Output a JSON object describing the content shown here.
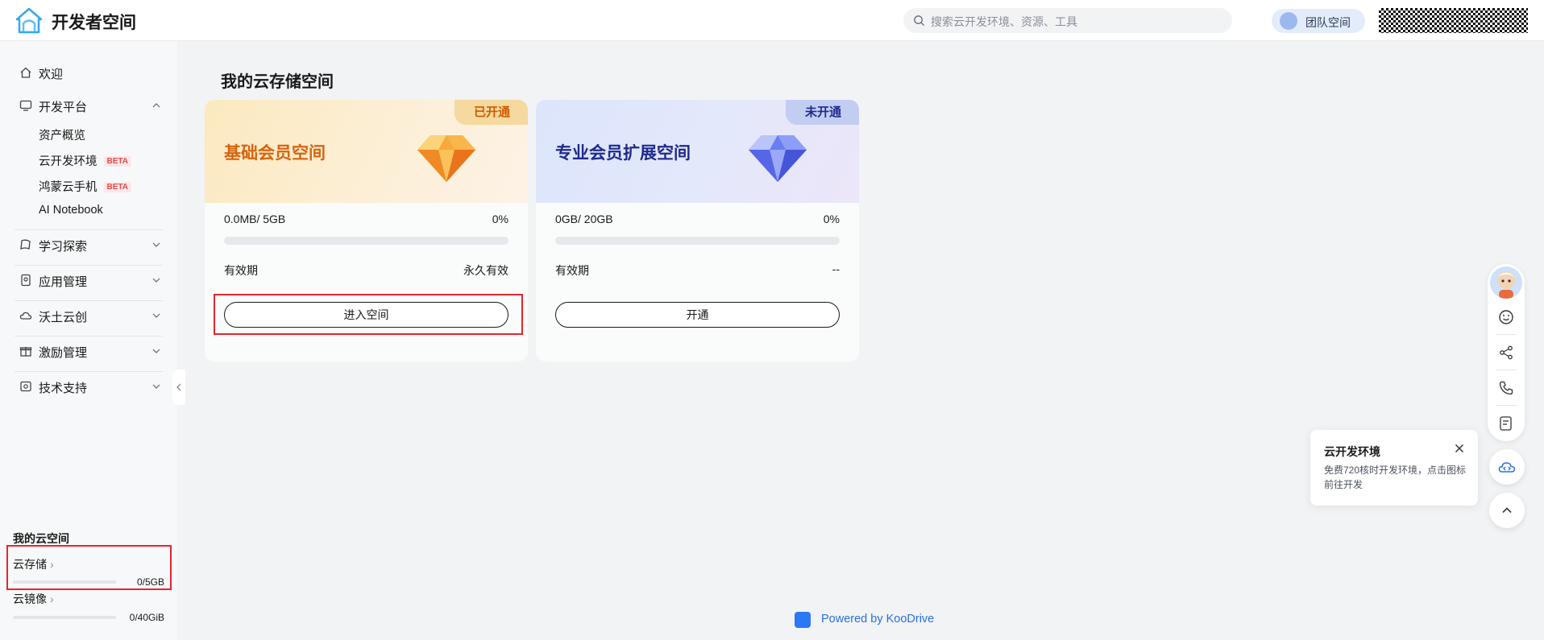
{
  "header": {
    "brand": "开发者空间",
    "search_placeholder": "搜索云开发环境、资源、工具",
    "team_label": "团队空间"
  },
  "sidebar": {
    "items": [
      {
        "label": "欢迎",
        "icon": "home-icon"
      },
      {
        "label": "开发平台",
        "icon": "monitor-icon",
        "expanded": true
      },
      {
        "label": "学习探索",
        "icon": "book-icon"
      },
      {
        "label": "应用管理",
        "icon": "app-icon"
      },
      {
        "label": "沃土云创",
        "icon": "cloud-icon"
      },
      {
        "label": "激励管理",
        "icon": "gift-icon"
      },
      {
        "label": "技术支持",
        "icon": "support-icon"
      }
    ],
    "sub_items": [
      {
        "label": "资产概览"
      },
      {
        "label": "云开发环境",
        "badge": "BETA"
      },
      {
        "label": "鸿蒙云手机",
        "badge": "BETA"
      },
      {
        "label": "AI Notebook"
      }
    ],
    "my_cloud_title": "我的云空间",
    "storage": [
      {
        "label": "云存储",
        "value": "0/5GB",
        "fraction": 0
      },
      {
        "label": "云镜像",
        "value": "0/40GiB",
        "fraction": 0
      }
    ]
  },
  "main": {
    "title": "我的云存储空间",
    "cards": [
      {
        "name": "基础会员空间",
        "status": "已开通",
        "usage": "0.0MB/ 5GB",
        "percent": "0%",
        "progress": 0,
        "validity_label": "有效期",
        "validity_value": "永久有效",
        "button": "进入空间",
        "theme": "gold"
      },
      {
        "name": "专业会员扩展空间",
        "status": "未开通",
        "usage": "0GB/ 20GB",
        "percent": "0%",
        "progress": 0,
        "validity_label": "有效期",
        "validity_value": "--",
        "button": "开通",
        "theme": "blue"
      }
    ],
    "footer": "Powered by KooDrive"
  },
  "popup": {
    "title": "云开发环境",
    "description": "免费720核时开发环境，点击图标前往开发"
  },
  "colors": {
    "highlight": "#e5242c",
    "gold_text": "#d6640f",
    "blue_text": "#1f2a8c",
    "link": "#2a6fe0"
  }
}
